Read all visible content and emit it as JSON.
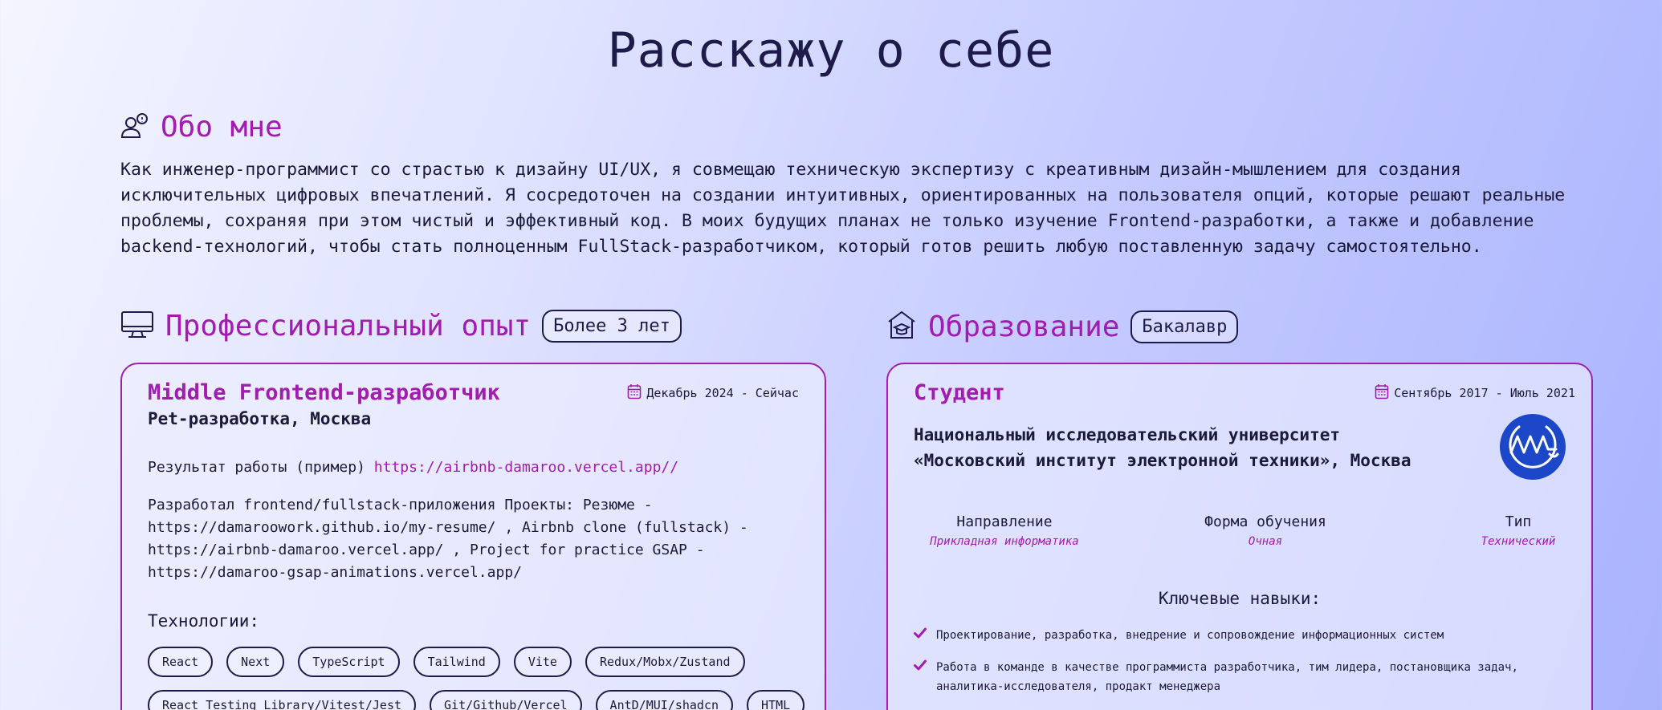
{
  "page_title": "Расскажу о себе",
  "about": {
    "title": "Обо мне",
    "icon": "user-speech-icon",
    "text": "Как инженер-программист со страстью к дизайну UI/UX, я совмещаю техническую экспертизу с креативным дизайн-мышлением для создания исключительных цифровых впечатлений. Я сосредоточен на создании интуитивных, ориентированных на пользователя опций, которые решают реальные проблемы, сохраняя при этом чистый и эффективный код. В моих будущих планах не только изучение Frontend-разработки, а также и добавление backend-технологий, чтобы стать полноценным FullStack-разработчиком, который готов решить любую поставленную задачу самостоятельно."
  },
  "experience": {
    "title": "Профессиональный опыт",
    "icon": "monitor-icon",
    "badge": "Более 3 лет",
    "role": "Middle Frontend-разработчик",
    "company": "Pet-разработка, Москва",
    "date": "Декабрь 2024 - Сейчас",
    "result_label": "Результат работы (пример)",
    "result_link": "https://airbnb-damaroo.vercel.app//",
    "description": "Разработал frontend/fullstack-приложения Проекты: Резюме - https://damaroowork.github.io/my-resume/ , Airbnb clone (fullstack) - https://airbnb-damaroo.vercel.app/ , Project for practice GSAP - https://damaroo-gsap-animations.vercel.app/",
    "tech_label": "Технологии:",
    "technologies": [
      "React",
      "Next",
      "TypeScript",
      "Tailwind",
      "Vite",
      "Redux/Mobx/Zustand",
      "React Testing Library/Vitest/Jest",
      "Git/Github/Vercel",
      "AntD/MUI/shadcn",
      "HTML"
    ]
  },
  "education": {
    "title": "Образование",
    "icon": "school-icon",
    "badge": "Бакалавр",
    "role": "Студент",
    "date": "Сентябрь 2017 - Июль 2021",
    "university_line1": "Национальный исследовательский университет",
    "university_line2": "«Московский институт электронной техники», Москва",
    "facts": [
      {
        "label": "Направление",
        "value": "Прикладная информатика"
      },
      {
        "label": "Форма обучения",
        "value": "Очная"
      },
      {
        "label": "Тип",
        "value": "Технический"
      }
    ],
    "skills_title": "Ключевые навыки:",
    "skills": [
      "Проектирование, разработка, внедрение и сопровождение информационных систем",
      "Работа в команде в качестве программиста разработчика, тим лидера, постановщика задач, аналитика-исследователя, продакт менеджера"
    ]
  },
  "colors": {
    "accent": "#a21caf",
    "text": "#1e1b4b",
    "logo": "#1d47c9"
  }
}
